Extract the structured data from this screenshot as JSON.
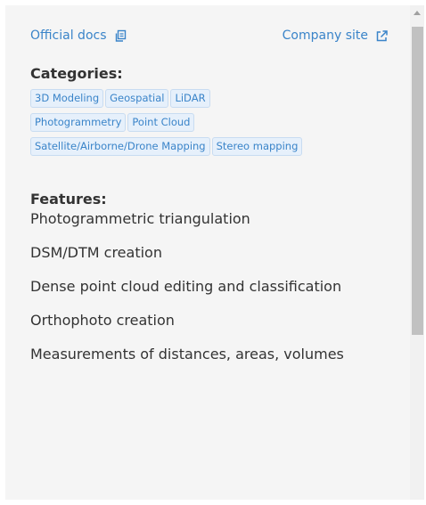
{
  "links": {
    "official_docs": "Official docs",
    "company_site": "Company site"
  },
  "categories": {
    "title": "Categories:",
    "tags": [
      "3D Modeling",
      "Geospatial",
      "LiDAR",
      "Photogrammetry",
      "Point Cloud",
      "Satellite/Airborne/Drone Mapping",
      "Stereo mapping"
    ]
  },
  "features": {
    "title": "Features:",
    "items": [
      "Photogrammetric triangulation",
      "DSM/DTM creation",
      "Dense point cloud editing and classification",
      "Orthophoto creation",
      "Measurements of distances, areas, volumes"
    ]
  },
  "icons": {
    "official_docs_icon": "copy-icon",
    "company_site_icon": "external-link-icon"
  },
  "colors": {
    "link": "#3a84c9",
    "tag_bg": "#e6f0fb",
    "panel_bg": "#f5f5f5"
  }
}
